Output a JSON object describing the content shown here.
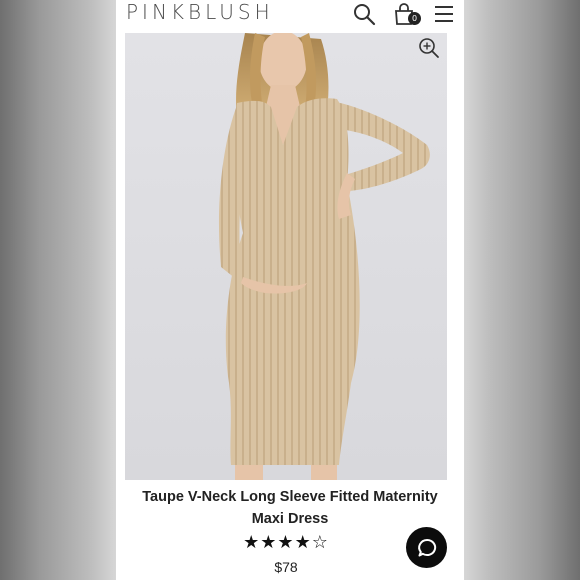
{
  "header": {
    "logo": "PINKBLUSH",
    "cart_count": "0",
    "icons": [
      "search-icon",
      "shopping-bag-icon",
      "hamburger-menu-icon"
    ]
  },
  "product": {
    "image_alt": "Model wearing taupe ribbed v-neck maternity dress",
    "zoom_icon": "zoom-in-icon",
    "title": "Taupe V-Neck Long Sleeve Fitted Maternity Maxi Dress",
    "rating_stars": "★★★★☆",
    "rating_value": 4,
    "rating_max": 5,
    "price": "$78"
  },
  "chat": {
    "icon": "chat-bubble-icon"
  },
  "colors": {
    "dress": "#d9c3a2",
    "image_bg": "#dedee2",
    "text": "#222222",
    "chat_button": "#0c0c0c"
  }
}
